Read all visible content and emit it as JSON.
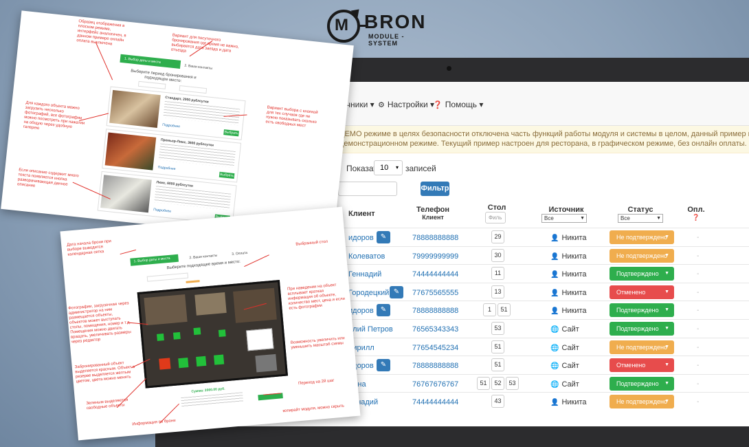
{
  "logo": {
    "letter": "M",
    "name": "BRON",
    "subtitle": "MODULE - SYSTEM"
  },
  "navbar": {
    "items": [
      {
        "label": "точники",
        "icon": ""
      },
      {
        "label": "Настройки",
        "icon": "gear-icon"
      },
      {
        "label": "Помощь",
        "icon": "help-icon"
      }
    ]
  },
  "alert": {
    "line1": "ДЕМО режиме в целях безопасности отключена часть функций работы модуля и системы в целом, данный пример панели адм",
    "line2": "демонстрационном режиме. Текущий пример настроен для ресторана, в графическом режиме, без онлайн оплаты."
  },
  "controls": {
    "show_label": "Показать",
    "show_value": "10",
    "records_label": "записей",
    "filter_button": "Фильтр"
  },
  "table": {
    "headers": {
      "client": "Клиент",
      "phone": "Телефон",
      "phone_sub": "Клиент",
      "table": "Стол",
      "table_filter_placeholder": "Филь",
      "source": "Источник",
      "source_filter": "Все",
      "status": "Статус",
      "status_filter": "Все",
      "paid": "Опл."
    },
    "rows": [
      {
        "client": "идоров",
        "edit": true,
        "phone": "78888888888",
        "tables": [
          "29"
        ],
        "source": "Никита",
        "source_icon": "user-icon",
        "status": "Не подтверждено",
        "status_color": "#f0ad4e",
        "paid": "-"
      },
      {
        "client": "Колеватов",
        "edit": false,
        "phone": "79999999999",
        "tables": [
          "30"
        ],
        "source": "Никита",
        "source_icon": "user-icon",
        "status": "Не подтверждено",
        "status_color": "#f0ad4e",
        "paid": "-"
      },
      {
        "client": "Геннадий",
        "edit": false,
        "phone": "74444444444",
        "tables": [
          "11"
        ],
        "source": "Никита",
        "source_icon": "user-icon",
        "status": "Подтверждено",
        "status_color": "#2eae4d",
        "paid": "-"
      },
      {
        "client": "Городецкий",
        "edit": true,
        "phone": "77675565555",
        "tables": [
          "13"
        ],
        "source": "Никита",
        "source_icon": "user-icon",
        "status": "Отменено",
        "status_color": "#e74c4c",
        "paid": "-"
      },
      {
        "client": "идоров",
        "edit": true,
        "phone": "78888888888",
        "tables": [
          "1",
          "51"
        ],
        "source": "Никита",
        "source_icon": "user-icon",
        "status": "Подтверждено",
        "status_color": "#2eae4d",
        "paid": "-"
      },
      {
        "client": "илий Петров",
        "edit": false,
        "phone": "76565343343",
        "tables": [
          "53"
        ],
        "source": "Сайт",
        "source_icon": "globe-icon",
        "status": "Подтверждено",
        "status_color": "#2eae4d",
        "paid": "-"
      },
      {
        "client": "Кирилл",
        "edit": false,
        "phone": "77654545234",
        "tables": [
          "51"
        ],
        "source": "Сайт",
        "source_icon": "globe-icon",
        "status": "Не подтверждено",
        "status_color": "#f0ad4e",
        "paid": "-"
      },
      {
        "client": "идоров",
        "edit": true,
        "phone": "78888888888",
        "tables": [
          "51"
        ],
        "source": "Сайт",
        "source_icon": "globe-icon",
        "status": "Отменено",
        "status_color": "#e74c4c",
        "paid": "-"
      },
      {
        "client": "Анна",
        "edit": false,
        "phone": "76767676767",
        "tables": [
          "51",
          "52",
          "53"
        ],
        "source": "Сайт",
        "source_icon": "globe-icon",
        "status": "Подтверждено",
        "status_color": "#2eae4d",
        "paid": "-"
      },
      {
        "client": "еннадий",
        "edit": false,
        "phone": "74444444444",
        "tables": [
          "43"
        ],
        "source": "Никита",
        "source_icon": "user-icon",
        "status": "Не подтверждено",
        "status_color": "#f0ad4e",
        "paid": "-"
      }
    ]
  },
  "paper1": {
    "step1": "1. Выбор даты и места",
    "step2": "2. Ваши контакты",
    "heading": "Выберите период бронирования и подходящее место:",
    "rooms": [
      {
        "title": "Стандарт, 2000 рублсутки",
        "button": "Выбрать",
        "link": "Подробнее"
      },
      {
        "title": "Премьер-Люкс, 3600 рублсутки",
        "button": "Выбрать",
        "link": "Подробнее"
      },
      {
        "title": "Люкс, 6000 рублсутки",
        "button": "Выбрать",
        "link": "Подробнее"
      }
    ],
    "notes": [
      "Образец отображения в плоском режиме, интерфейс аналогичен, в данном примере онлайн оплата выключена",
      "Вариант для посуточного бронирования где время не важно, выбирается дата заезда и дата отъезда",
      "Вариант выбора с кнопкой для тех случаев где не нужно показывать сколько есть свободных мест",
      "Для каждого объекта можно загрузить несколько фотографий, все фотографии можно посмотреть при нажатии на общую через удобную галерею",
      "Если описание содержит много текста появляется кнопка разворачивающая данное описание"
    ]
  },
  "paper2": {
    "step1": "1. Выбор даты и места",
    "step2": "2. Ваши контакты",
    "step3": "3. Оплата",
    "heading": "Выберите подходящее время и место:",
    "sum": "Сумма: 2000.00 руб.",
    "notes": [
      "Дата начала брони при выборе выводится календарная сетка",
      "Выбранный стол",
      "Фотографии, загрузочная через администратор на ним размещается объекты, объектов может выступать столы, помещения, номер и т.д. Помещения можно двигать вращать, увеличивать размеры через редактор",
      "При наведении на объект всплывает краткая информация об объекте, количество мест, цена и если есть фотографии",
      "Забронированный объект выделяется красным. Объект в резерве выделяется желтым цветом, цвета можно менять",
      "Возможность увеличить или уменьшить масштаб схемы",
      "Зеленым выделяются свободные объекты",
      "Информация по брони",
      "Переход на 2й шаг",
      "копирайт модуля, можно скрыть"
    ]
  }
}
